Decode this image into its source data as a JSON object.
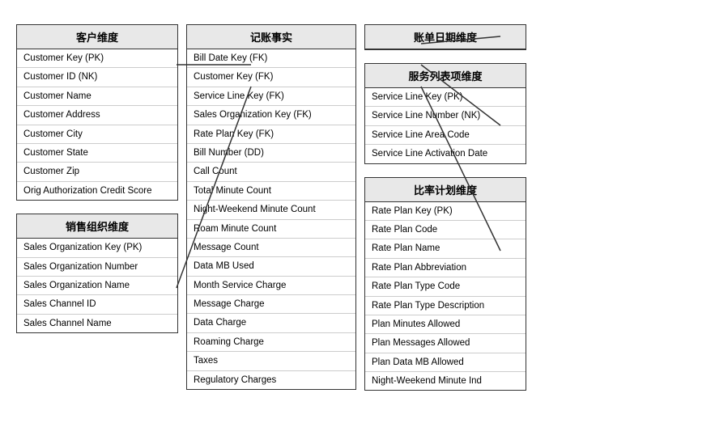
{
  "tables": {
    "customer": {
      "header": "客户维度",
      "rows": [
        "Customer Key (PK)",
        "Customer ID (NK)",
        "Customer Name",
        "Customer Address",
        "Customer City",
        "Customer State",
        "Customer Zip",
        "Orig Authorization Credit Score"
      ]
    },
    "sales_org": {
      "header": "销售组织维度",
      "rows": [
        "Sales Organization Key (PK)",
        "Sales Organization Number",
        "Sales Organization Name",
        "Sales Channel ID",
        "Sales Channel Name"
      ]
    },
    "billing_fact": {
      "header": "记账事实",
      "rows": [
        "Bill Date Key (FK)",
        "Customer Key (FK)",
        "Service Line Key (FK)",
        "Sales Organization Key (FK)",
        "Rate Plan Key (FK)",
        "Bill Number (DD)",
        "Call Count",
        "Total Minute Count",
        "Night-Weekend Minute Count",
        "Roam Minute Count",
        "Message Count",
        "Data MB Used",
        "Month Service Charge",
        "Message Charge",
        "Data Charge",
        "Roaming Charge",
        "Taxes",
        "Regulatory Charges"
      ]
    },
    "bill_date": {
      "header": "账单日期维度",
      "rows": []
    },
    "service_line": {
      "header": "服务列表项维度",
      "rows": [
        "Service Line Key (PK)",
        "Service Line Number (NK)",
        "Service Line Area Code",
        "Service Line Activation Date"
      ]
    },
    "rate_plan": {
      "header": "比率计划维度",
      "rows": [
        "Rate Plan Key (PK)",
        "Rate Plan Code",
        "Rate Plan Name",
        "Rate Plan Abbreviation",
        "Rate Plan Type Code",
        "Rate Plan Type Description",
        "Plan Minutes Allowed",
        "Plan Messages Allowed",
        "Plan Data MB Allowed",
        "Night-Weekend Minute Ind"
      ]
    }
  },
  "connectors": {
    "description": "Lines connecting fact table to dimension tables"
  }
}
